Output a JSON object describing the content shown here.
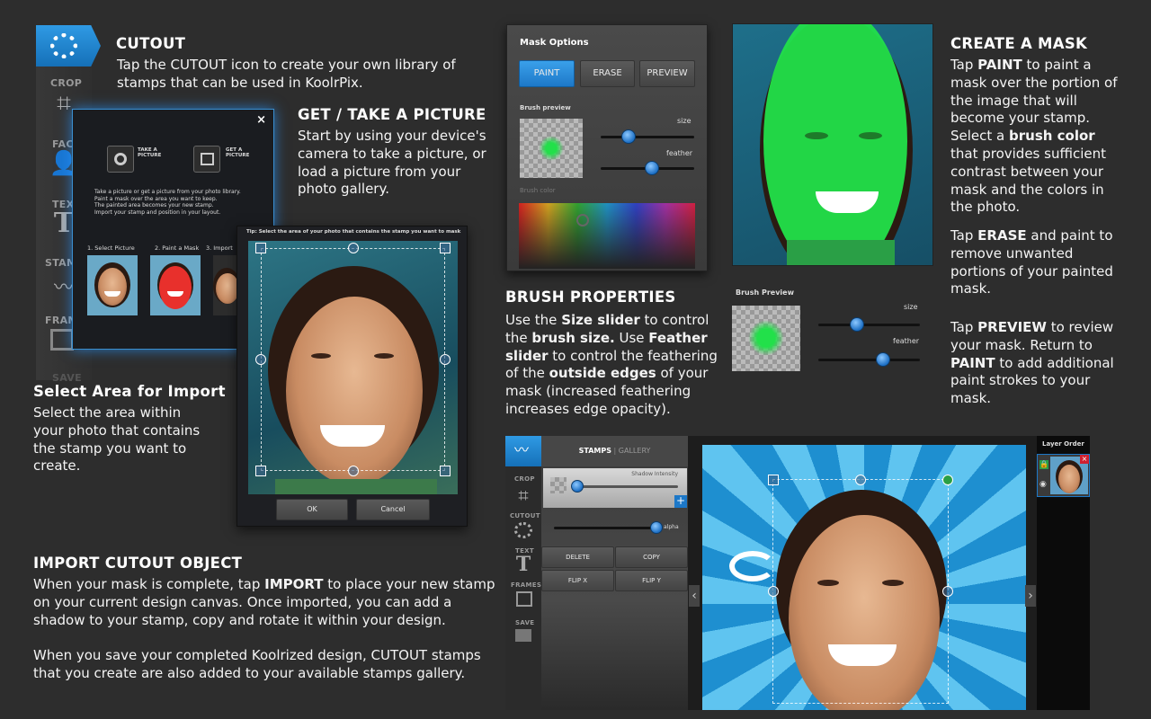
{
  "cutout": {
    "title": "CUTOUT",
    "text": "Tap the CUTOUT icon to create your own library of stamps that can be used in KoolrPix."
  },
  "app_sidebar": {
    "crop": "CROP",
    "face": "FACE",
    "text": "TEXT",
    "stamps": "STAMPS",
    "frames": "FRAMES",
    "save": "SAVE"
  },
  "dialog": {
    "close": "×",
    "take_picture": "TAKE A\nPICTURE",
    "get_picture": "GET A\nPICTURE",
    "instructions": "Take a picture or get a picture from your photo library.\nPaint a mask over the area you want to keep.\nThe painted area becomes your new stamp.\nImport your stamp and position in your layout.",
    "steps": [
      "1. Select Picture",
      "2. Paint a Mask",
      "3. Import"
    ]
  },
  "select_dialog": {
    "tip": "Tip: Select the area of your photo that contains the stamp you want to mask",
    "ok": "OK",
    "cancel": "Cancel"
  },
  "get_picture_section": {
    "title": "GET / TAKE A PICTURE",
    "text": "Start by using your device's camera to take a picture, or load a picture from your photo gallery."
  },
  "select_area": {
    "title": "Select Area for Import",
    "text": "Select the area within your photo that contains the stamp you want to create."
  },
  "import_cutout": {
    "title": "IMPORT CUTOUT OBJECT",
    "text1a": "When your mask is complete, tap ",
    "text1b": "IMPORT",
    "text1c": " to place your new stamp on your current design canvas. Once imported, you can add a shadow to your stamp, copy and rotate it within your design.",
    "text2": "When you save your completed Koolrized design, CUTOUT stamps that you create are also added to your available stamps gallery."
  },
  "mask_options": {
    "title": "Mask Options",
    "paint": "PAINT",
    "erase": "ERASE",
    "preview": "PREVIEW",
    "brush_preview": "Brush preview",
    "size": "size",
    "feather": "feather",
    "brush_color": "Brush color",
    "size_value": 0.3,
    "feather_value": 0.55
  },
  "brush_properties": {
    "title": "BRUSH PROPERTIES",
    "t1": "Use the ",
    "b1": "Size slider",
    "t2": " to control the ",
    "b2": "brush size.",
    "t3": " Use ",
    "b3": "Feather slider",
    "t4": " to control the feathering of the ",
    "b4": "outside edges",
    "t5": " of your mask (increased feathering increases edge opacity).",
    "brush_preview": "Brush Preview",
    "size": "size",
    "feather": "feather",
    "size_value": 0.38,
    "feather_value": 0.64
  },
  "create_mask": {
    "title": "CREATE A MASK",
    "p1a": "Tap ",
    "p1b": "PAINT",
    "p1c": " to paint a mask over the portion of the image that will become your stamp. Select a ",
    "p1d": "brush color",
    "p1e": " that provides sufficient contrast between your mask and the colors in the photo.",
    "p2a": "Tap ",
    "p2b": "ERASE",
    "p2c": " and paint to remove unwanted portions of your painted mask.",
    "p3a": "Tap ",
    "p3b": "PREVIEW",
    "p3c": " to review your mask. Return to ",
    "p3d": "PAINT",
    "p3e": " to add additional paint strokes to your mask."
  },
  "stamps_panel": {
    "tab_stamps": "STAMPS",
    "tab_sep": "|",
    "tab_gallery": "GALLERY",
    "shadow_intensity": "Shadow Intensity",
    "alpha": "alpha",
    "delete": "DELETE",
    "copy": "COPY",
    "flip_x": "FLIP X",
    "flip_y": "FLIP Y",
    "side": {
      "crop": "CROP",
      "cutout": "CUTOUT",
      "text": "TEXT",
      "frames": "FRAMES",
      "save": "SAVE"
    },
    "layer_order": "Layer Order",
    "shadow_value": 0.05,
    "alpha_value": 0.97
  },
  "colors": {
    "accent": "#1f8ad6",
    "mask_green": "#22e04a",
    "sky_blue": "#1e8fd0"
  }
}
